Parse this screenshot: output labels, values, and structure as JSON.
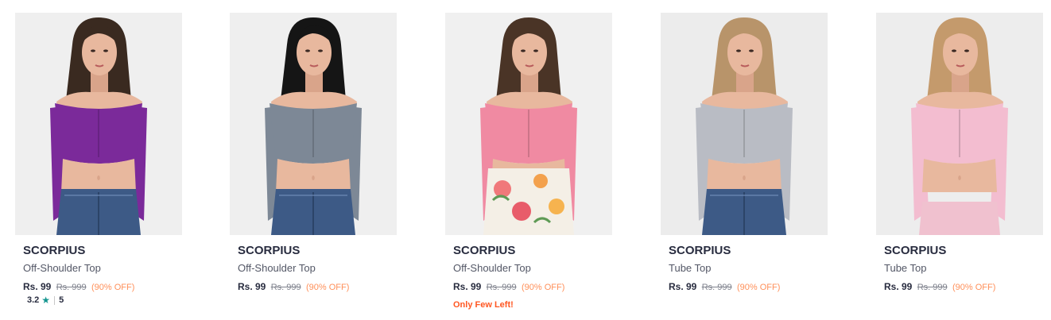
{
  "products": [
    {
      "brand": "SCORPIUS",
      "name": "Off-Shoulder Top",
      "price": "Rs. 99",
      "mrp": "Rs. 999",
      "discount": "(90% OFF)",
      "rating": {
        "score": "3.2",
        "count": "5"
      },
      "image": {
        "top_color": "#7b2a9a",
        "bottom": "denim",
        "hair": "#3a2a20",
        "bg": "#efefef"
      }
    },
    {
      "brand": "SCORPIUS",
      "name": "Off-Shoulder Top",
      "price": "Rs. 99",
      "mrp": "Rs. 999",
      "discount": "(90% OFF)",
      "image": {
        "top_color": "#7d8896",
        "bottom": "denim",
        "hair": "#151515",
        "bg": "#efefef"
      }
    },
    {
      "brand": "SCORPIUS",
      "name": "Off-Shoulder Top",
      "price": "Rs. 99",
      "mrp": "Rs. 999",
      "discount": "(90% OFF)",
      "stock_note": "Only Few Left!",
      "image": {
        "top_color": "#f08aa2",
        "bottom": "floral",
        "hair": "#4a3426",
        "bg": "#f0f0f0"
      }
    },
    {
      "brand": "SCORPIUS",
      "name": "Tube Top",
      "price": "Rs. 99",
      "mrp": "Rs. 999",
      "discount": "(90% OFF)",
      "image": {
        "top_color": "#b9bcc4",
        "bottom": "denim",
        "hair": "#b8946a",
        "bg": "#ececec"
      }
    },
    {
      "brand": "SCORPIUS",
      "name": "Tube Top",
      "price": "Rs. 99",
      "mrp": "Rs. 999",
      "discount": "(90% OFF)",
      "image": {
        "top_color": "#f3bdd0",
        "bottom": "pink",
        "hair": "#c49a6c",
        "bg": "#ededed"
      }
    }
  ]
}
